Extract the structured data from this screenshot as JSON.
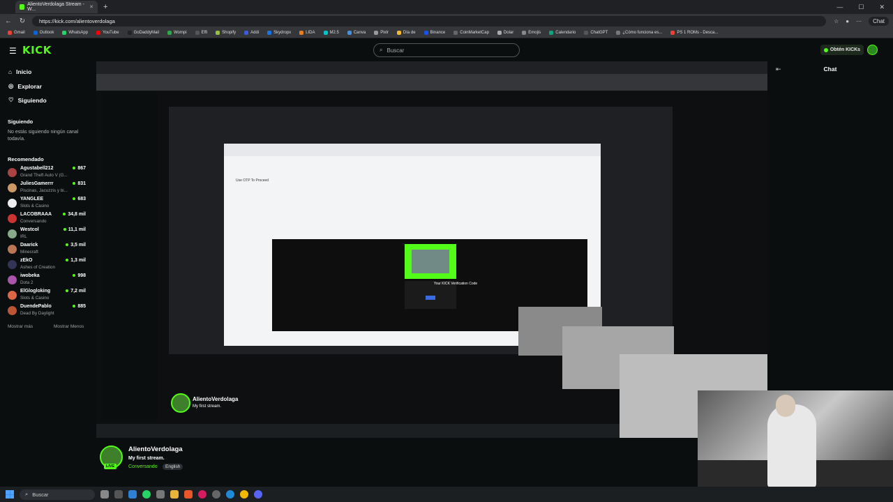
{
  "browser": {
    "tab_title": "AlientoVerdolaga Stream - W...",
    "url": "https://kick.com/alientoverdolaga",
    "chatgpt": "Chat",
    "bookmarks": [
      "Gmail",
      "Outlook",
      "WhatsApp",
      "YouTube",
      "GoDaddyMail",
      "Wompi",
      "Effi",
      "Shopify",
      "Addi",
      "Skydropx",
      "LIDA",
      "M2.5",
      "Canva",
      "Pixlr",
      "Día de",
      "Binance",
      "CoinMarketCap",
      "Dolar",
      "Emojis",
      "Calendario",
      "ChatGPT",
      "¿Cómo funciona es...",
      "PS 1 ROMs - Desca..."
    ]
  },
  "header": {
    "logo": "KICK",
    "search_placeholder": "Buscar",
    "get_kicks": "Obtén KICKs"
  },
  "sidebar": {
    "nav": [
      {
        "label": "Inicio"
      },
      {
        "label": "Explorar"
      },
      {
        "label": "Siguiendo"
      }
    ],
    "following_title": "Siguiendo",
    "not_following": "No estás siguiendo ningún canal todavía.",
    "recommended_title": "Recomendado",
    "recommended": [
      {
        "name": "Agustabell212",
        "category": "Grand Theft Auto V (G...",
        "viewers": "867",
        "color": "#a44"
      },
      {
        "name": "JuliesGamerrr",
        "category": "Piscinas, Jacuzzis y bi...",
        "viewers": "831",
        "color": "#c96"
      },
      {
        "name": "YANGLEE",
        "category": "Slots & Casino",
        "viewers": "683",
        "color": "#eee"
      },
      {
        "name": "LACOBRAAA",
        "category": "Conversando",
        "viewers": "34,8 mil",
        "color": "#c33"
      },
      {
        "name": "Westcol",
        "category": "IRL",
        "viewers": "11,1 mil",
        "color": "#8a8"
      },
      {
        "name": "Daarick",
        "category": "Minecraft",
        "viewers": "3,5 mil",
        "color": "#b75"
      },
      {
        "name": "zEkO",
        "category": "Ashes of Creation",
        "viewers": "1,3 mil",
        "color": "#335"
      },
      {
        "name": "iwobeka",
        "category": "Dota 2",
        "viewers": "998",
        "color": "#a5a"
      },
      {
        "name": "ElGlogloking",
        "category": "Slots & Casino",
        "viewers": "7,2 mil",
        "color": "#d64"
      },
      {
        "name": "DuendePablo",
        "category": "Dead By Daylight",
        "viewers": "885",
        "color": "#b53"
      }
    ],
    "show_more": "Mostrar más",
    "show_less": "Mostrar Menos"
  },
  "chat": {
    "title": "Chat"
  },
  "stream": {
    "channel": "AlientoVerdolaga",
    "title": "My first stream.",
    "category": "Conversando",
    "tag": "English",
    "live": "LIVE"
  },
  "nested": {
    "verification_title": "Your KICK Verification Code",
    "email_subject": "Use OTP To Proceed"
  },
  "taskbar": {
    "search": "Buscar"
  }
}
